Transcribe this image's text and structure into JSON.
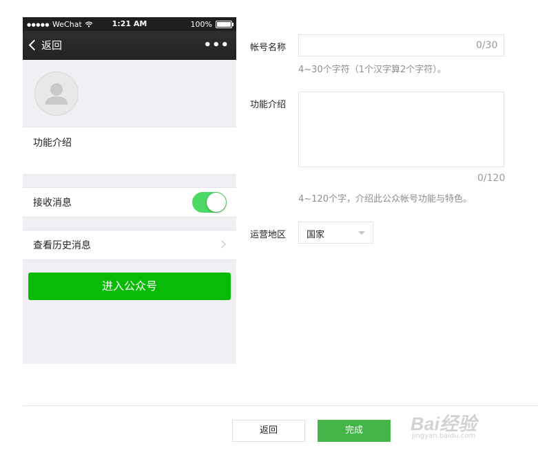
{
  "phone": {
    "status": {
      "carrier": "WeChat",
      "time": "1:21 AM",
      "battery": "100%"
    },
    "nav": {
      "back_label": "返回",
      "more_label": "•••"
    },
    "intro_label": "功能介绍",
    "receive_label": "接收消息",
    "receive_on": true,
    "history_label": "查看历史消息",
    "enter_button": "进入公众号"
  },
  "form": {
    "account_name": {
      "label": "帐号名称",
      "value": "",
      "counter": "0/30",
      "hint": "4~30个字符（1个汉字算2个字符）。"
    },
    "intro": {
      "label": "功能介绍",
      "value": "",
      "counter": "0/120",
      "hint": "4~120个字，介绍此公众帐号功能与特色。"
    },
    "region": {
      "label": "运营地区",
      "selected": "国家"
    }
  },
  "footer": {
    "back_button": "返回",
    "done_button": "完成"
  },
  "watermark": {
    "brand": "Bai经验",
    "url": "jingyan.baidu.com"
  },
  "colors": {
    "accent_green": "#09bb07",
    "done_green": "#44b549",
    "switch_green": "#4cd964"
  }
}
